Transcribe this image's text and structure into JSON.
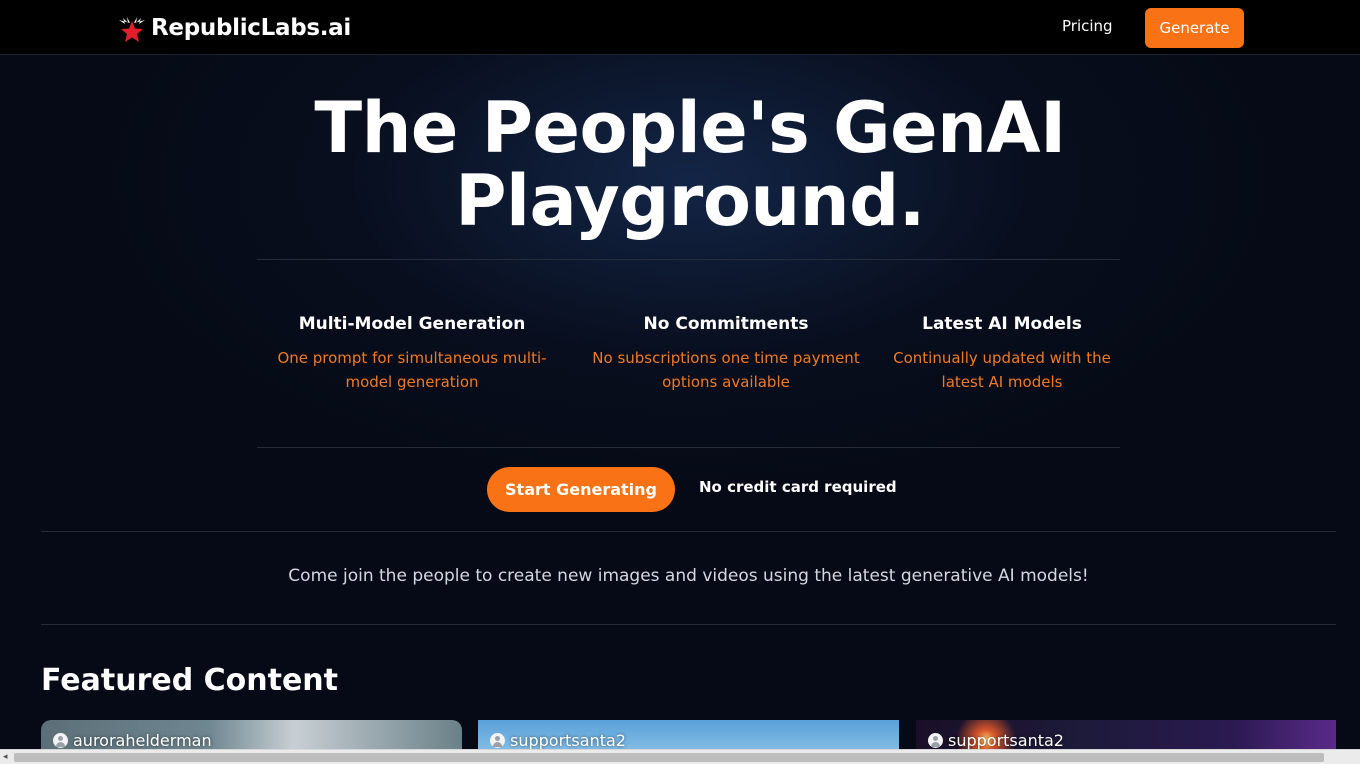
{
  "header": {
    "brand": "RepublicLabs.ai",
    "logo_icon": "star-wings-logo",
    "nav_pricing": "Pricing",
    "nav_generate": "Generate"
  },
  "hero": {
    "title": "The People's GenAI Playground."
  },
  "features": [
    {
      "title": "Multi-Model Generation",
      "description": "One prompt for simultaneous multi-model generation"
    },
    {
      "title": "No Commitments",
      "description": "No subscriptions one time payment options available"
    },
    {
      "title": "Latest AI Models",
      "description": "Continually updated with the latest AI models"
    }
  ],
  "cta": {
    "button": "Start Generating",
    "note": "No credit card required"
  },
  "tagline": "Come join the people to create new images and videos using the latest generative AI models!",
  "featured": {
    "title": "Featured Content",
    "cards": [
      {
        "user": "aurorahelderman"
      },
      {
        "user": "supportsanta2"
      },
      {
        "user": "supportsanta2"
      }
    ]
  },
  "colors": {
    "accent": "#f97316",
    "background": "#060a16",
    "feature_desc": "#f07a24"
  }
}
